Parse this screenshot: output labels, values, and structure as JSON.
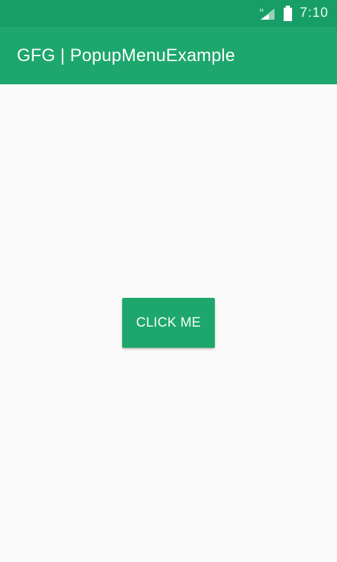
{
  "colors": {
    "status_bar": "#179e66",
    "app_bar": "#1da76c",
    "button": "#1da76c",
    "background": "#fafafa",
    "text_on_primary": "#ffffff"
  },
  "status_bar": {
    "time": "7:10",
    "icons": [
      "signal-icon",
      "battery-icon"
    ]
  },
  "app_bar": {
    "title": "GFG | PopupMenuExample"
  },
  "main": {
    "button_label": "CLICK ME"
  }
}
